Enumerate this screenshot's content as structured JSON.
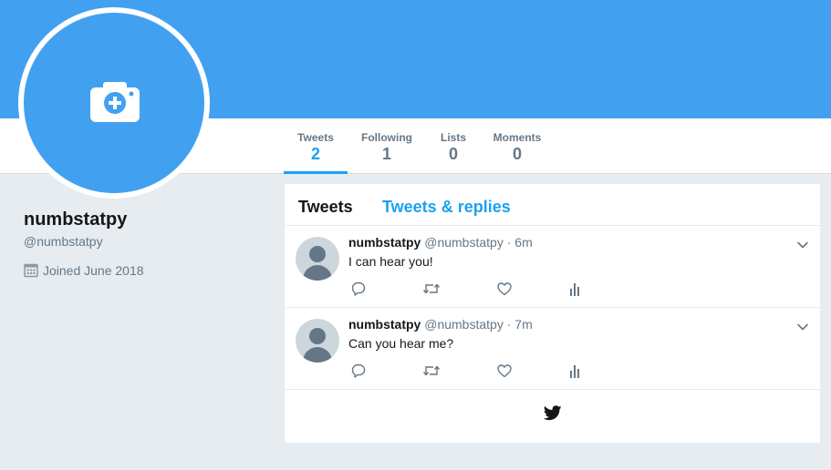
{
  "profile": {
    "name": "numbstatpy",
    "handle": "@numbstatpy",
    "joined": "Joined June 2018"
  },
  "nav": [
    {
      "label": "Tweets",
      "count": "2"
    },
    {
      "label": "Following",
      "count": "1"
    },
    {
      "label": "Lists",
      "count": "0"
    },
    {
      "label": "Moments",
      "count": "0"
    }
  ],
  "timeline": {
    "tabs": [
      "Tweets",
      "Tweets & replies"
    ]
  },
  "tweets": [
    {
      "name": "numbstatpy",
      "handle": "@numbstatpy",
      "separator": "·",
      "time": "6m",
      "text": "I can hear you!"
    },
    {
      "name": "numbstatpy",
      "handle": "@numbstatpy",
      "separator": "·",
      "time": "7m",
      "text": "Can you hear me?"
    }
  ],
  "icons": [
    "camera-icon",
    "calendar-icon",
    "reply-icon",
    "retweet-icon",
    "like-icon",
    "analytics-icon",
    "chevron-down-icon",
    "twitter-bird-icon"
  ],
  "colors": {
    "accent": "#1da1f2",
    "banner": "#41a1f0",
    "muted": "#657786",
    "background": "#e6ecf0"
  }
}
